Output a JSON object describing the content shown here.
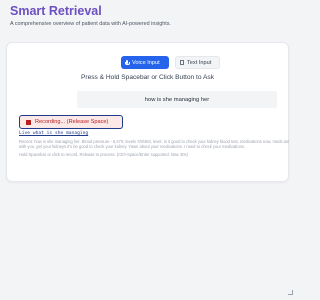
{
  "header": {
    "title": "Smart Retrieval",
    "subtitle": "A comprehensive overview of patient data with AI-powered insights."
  },
  "input_modes": {
    "voice_label": "Voice Input",
    "text_label": "Text Input",
    "active": "voice"
  },
  "voice_panel": {
    "instructions": "Press & Hold Spacebar or Click Button to Ask",
    "transcript": "how is she managing her",
    "recording_label": "Recording... (Release Space)",
    "live_text": "Live what is she managing",
    "log_lines": [
      "Recent: how is she managing her. Blood pressure - 8,470, levels 7/8/483, level. Is it good to check your kidney blood test, medications now, meds are low",
      "with you, get your kidneys it's be good to check your kidney. Yawn about your medications. I need to check your medications.",
      "Hold Spacebar or click to record. Release to process. (Ctrl+Space/Enter supported. Max 30s)"
    ]
  },
  "colors": {
    "title": "#6d4fc2",
    "primary": "#2563eb",
    "recording": "#b91c1c",
    "recording_bg": "#fde8e8"
  },
  "icons": {
    "voice": "microphone-icon",
    "text": "document-icon",
    "recording": "stop-icon"
  }
}
